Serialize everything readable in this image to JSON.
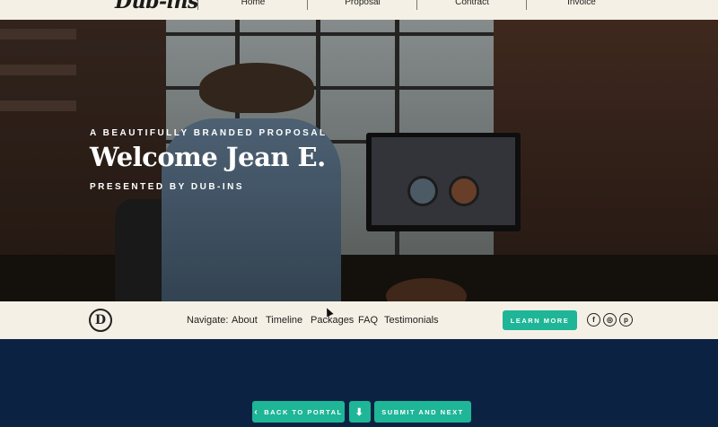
{
  "topnav": {
    "logo": "Dub-ins",
    "links": [
      "Home",
      "Proposal",
      "Contract",
      "Invoice"
    ]
  },
  "hero": {
    "eyebrow": "A BEAUTIFULLY BRANDED PROPOSAL",
    "title": "Welcome Jean E.",
    "presented_by": "PRESENTED BY DUB-INS"
  },
  "subnav": {
    "badge_letter": "D",
    "navigate_label": "Navigate:",
    "links": [
      "About",
      "Timeline",
      "Packages",
      "FAQ",
      "Testimonials"
    ],
    "learn_more": "LEARN MORE",
    "social": [
      "facebook-icon",
      "instagram-icon",
      "pinterest-icon"
    ]
  },
  "footer": {
    "back_label": "BACK TO PORTAL",
    "back_glyph": "‹",
    "download_glyph": "⬇",
    "submit_label": "SUBMIT AND NEXT"
  },
  "colors": {
    "accent": "#1fb597",
    "cream": "#f5f0e6",
    "navy": "#0c2243"
  }
}
